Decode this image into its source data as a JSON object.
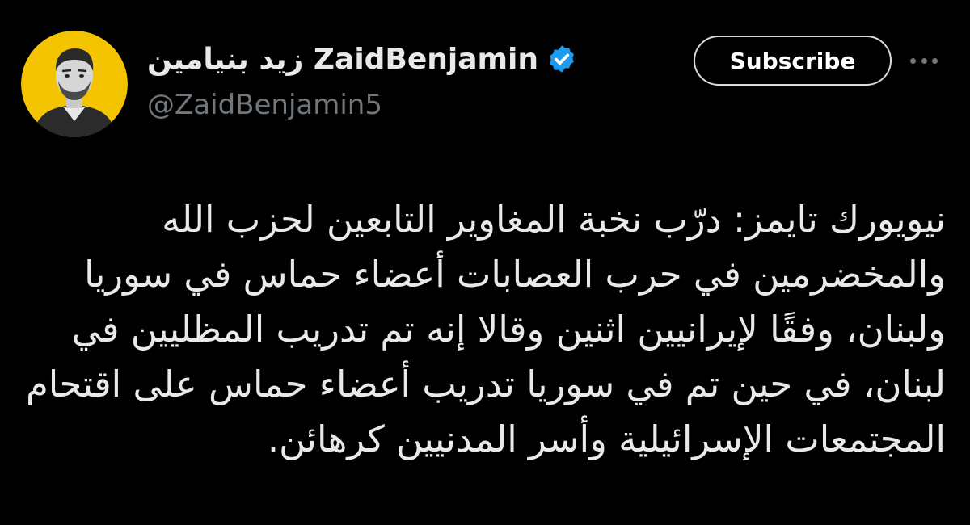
{
  "author": {
    "display_name": "زيد بنيامين ZaidBenjamin",
    "handle": "@ZaidBenjamin5",
    "verified_icon": "verified-badge-icon",
    "avatar_bg_color": "#f5c400"
  },
  "actions": {
    "subscribe_label": "Subscribe",
    "more_icon": "more-horizontal-icon"
  },
  "tweet": {
    "text": "نيويورك تايمز: درّب نخبة المغاوير التابعين لحزب الله\nوالمخضرمين في حرب العصابات أعضاء حماس في سوريا\nولبنان، وفقًا لإيرانيين اثنين وقالا إنه تم تدريب المظليين في\nلبنان، في حين تم في سوريا تدريب أعضاء حماس على اقتحام\nالمجتمعات الإسرائيلية وأسر المدنيين كرهائن."
  },
  "colors": {
    "background": "#000000",
    "text_primary": "#e7e9ea",
    "text_secondary": "#71767b",
    "verified_blue": "#1d9bf0"
  }
}
